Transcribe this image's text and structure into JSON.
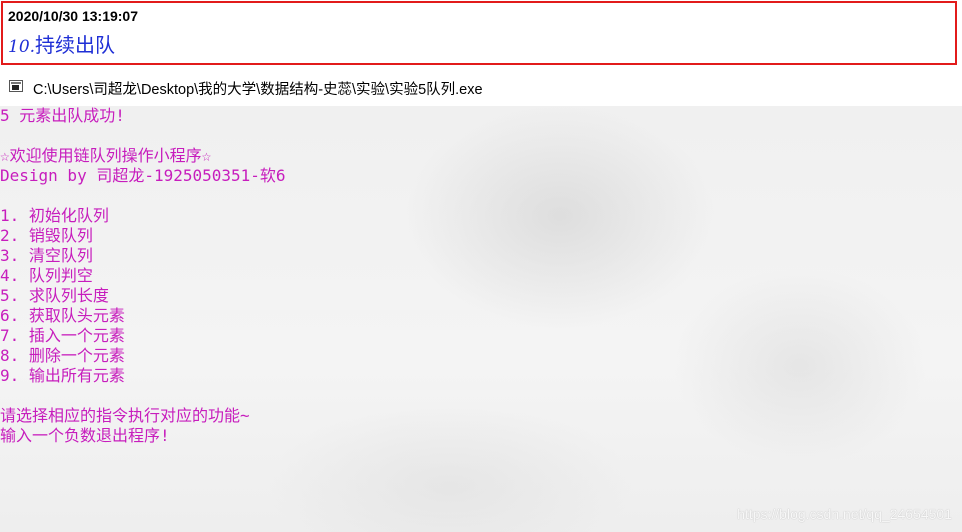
{
  "note": {
    "timestamp": "2020/10/30 13:19:07",
    "number": "10.",
    "title": "持续出队"
  },
  "window": {
    "icon": "console-window-icon",
    "title": "C:\\Users\\司超龙\\Desktop\\我的大学\\数据结构-史蕊\\实验\\实验5队列.exe"
  },
  "console": {
    "text_color": "#c71dbd",
    "lines": [
      "5 元素出队成功!",
      "",
      "☆欢迎使用链队列操作小程序☆",
      "Design by 司超龙-1925050351-软6",
      "",
      "1. 初始化队列",
      "2. 销毁队列",
      "3. 清空队列",
      "4. 队列判空",
      "5. 求队列长度",
      "6. 获取队头元素",
      "7. 插入一个元素",
      "8. 删除一个元素",
      "9. 输出所有元素",
      "",
      "请选择相应的指令执行对应的功能~",
      "输入一个负数退出程序!"
    ]
  },
  "watermark": "https://blog.csdn.net/qq_24654501"
}
